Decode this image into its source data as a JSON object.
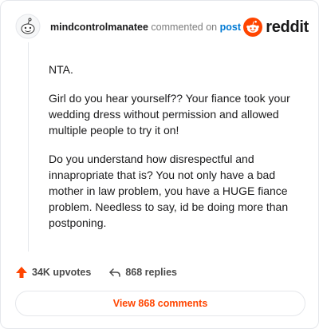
{
  "header": {
    "username": "mindcontrolmanatee",
    "action_text": "commented on",
    "post_link": "post",
    "brand_word": "reddit"
  },
  "comment": {
    "paragraphs": [
      "NTA.",
      "Girl do you hear yourself?? Your fiance took your wedding dress without permission and allowed multiple people to try it on!",
      "Do you understand how disrespectful and innapropriate that is? You not only have a bad mother in law problem, you have a HUGE fiance problem. Needless to say, id be doing more than postponing."
    ]
  },
  "actions": {
    "upvotes": "34K upvotes",
    "replies": "868 replies"
  },
  "cta": {
    "label": "View 868 comments"
  },
  "icons": {
    "avatar": "snoo-avatar-icon",
    "logo": "reddit-logo-icon",
    "upvote": "upvote-arrow-icon",
    "reply": "reply-arrow-icon"
  },
  "colors": {
    "accent": "#ff4500",
    "link": "#0079d3"
  }
}
